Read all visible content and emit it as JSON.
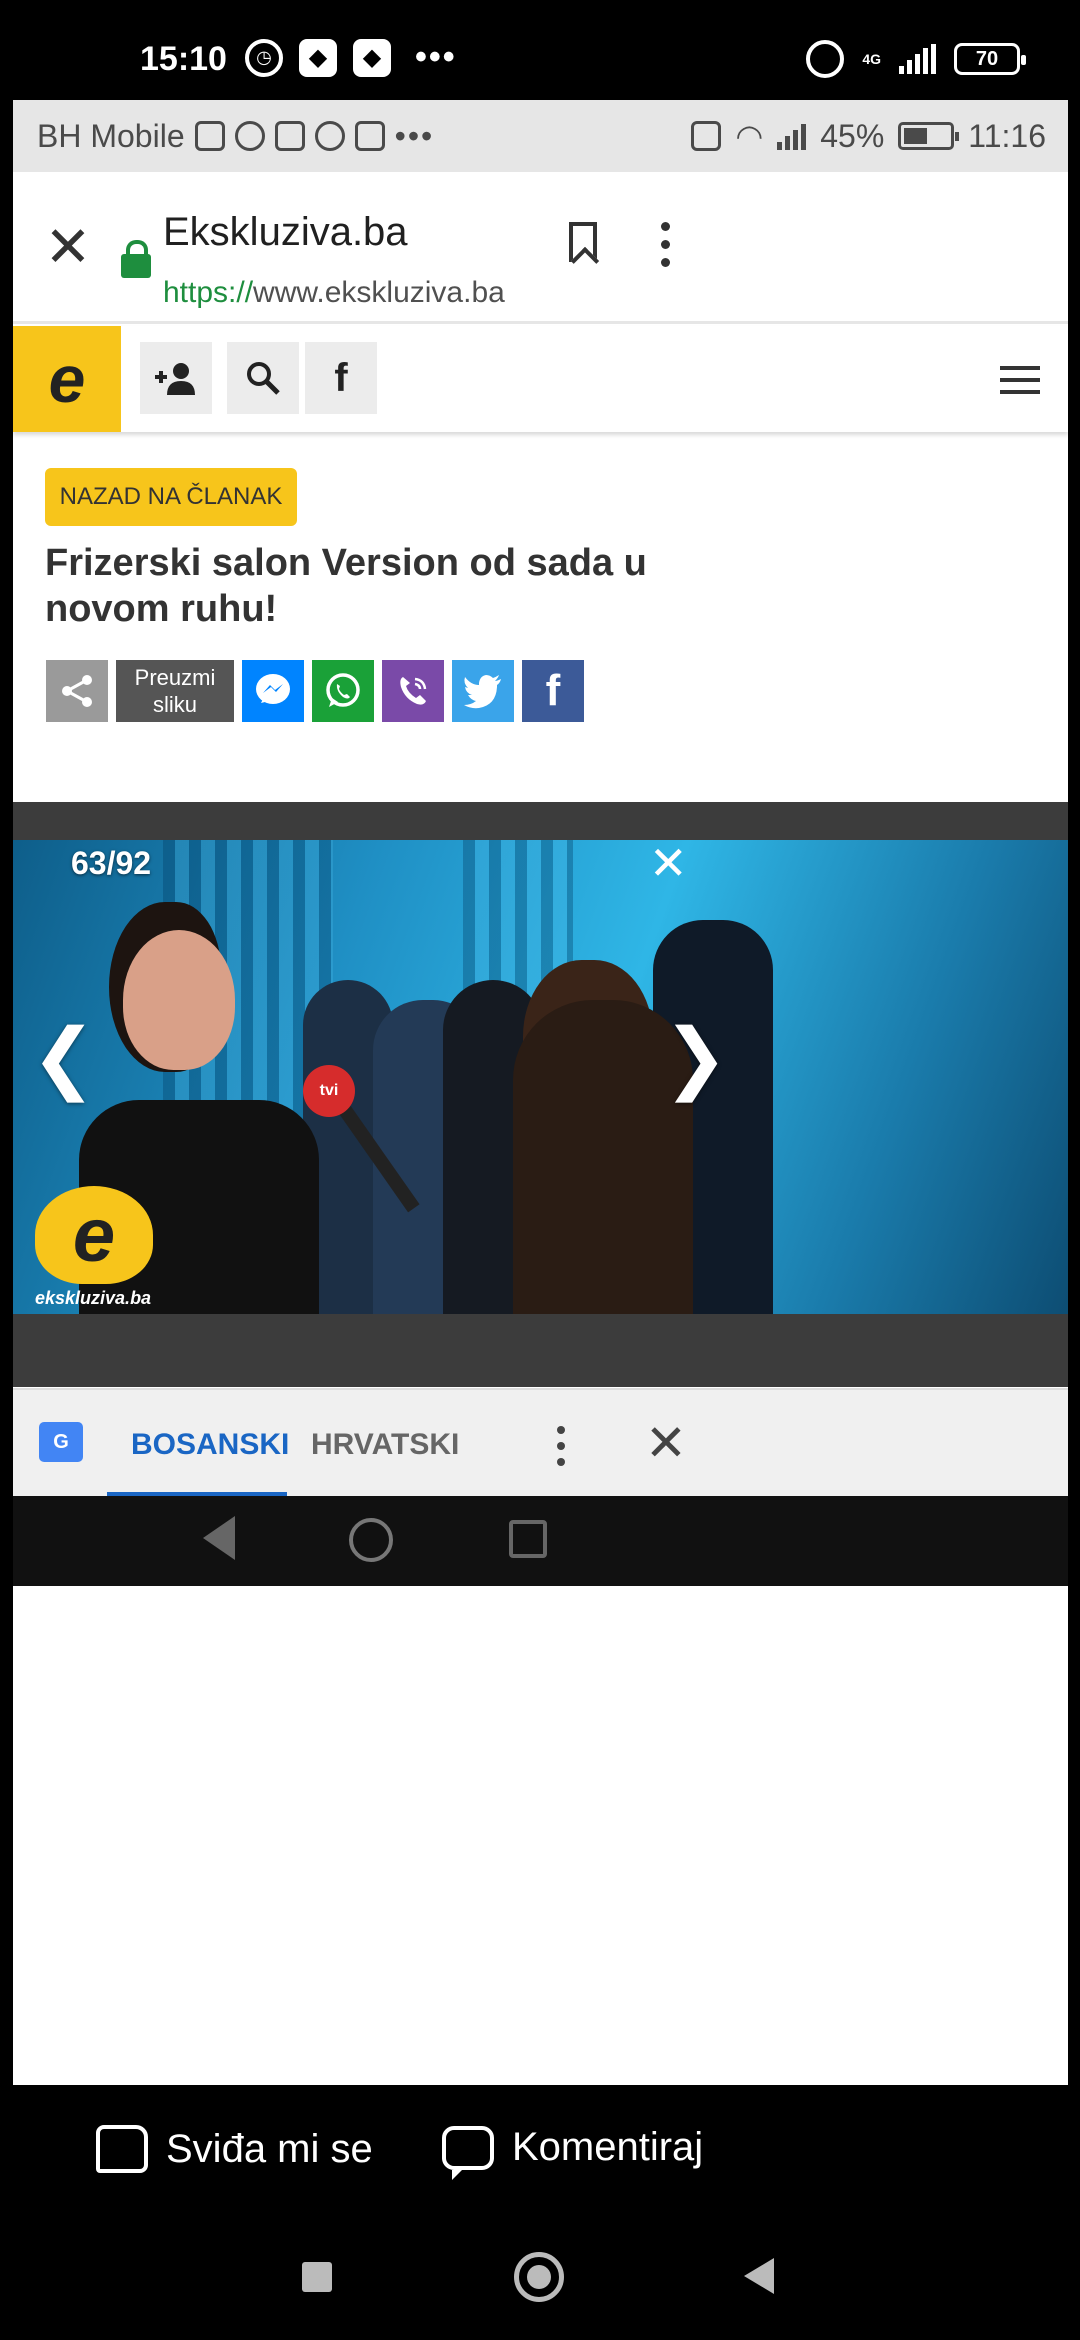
{
  "outer_status": {
    "time": "15:10",
    "network": "4G",
    "battery": "70"
  },
  "inner_status": {
    "carrier": "BH Mobile",
    "battery": "45%",
    "time": "11:16"
  },
  "browser": {
    "title": "Ekskluziva.ba",
    "url_scheme": "https://",
    "url_rest": "www.ekskluziva.ba"
  },
  "site": {
    "logo_letter": "e",
    "nav_icons": [
      "add-user-icon",
      "search-icon",
      "facebook-icon"
    ],
    "menu_icon": "hamburger-icon"
  },
  "article": {
    "back_label": "NAZAD NA ČLANAK",
    "headline": "Frizerski salon Version od sada u novom ruhu!",
    "download_label": "Preuzmi sliku",
    "share_buttons": [
      {
        "name": "share-icon",
        "color": "#9a9a9a"
      },
      {
        "name": "messenger-icon",
        "color": "#0084ff"
      },
      {
        "name": "whatsapp-icon",
        "color": "#1aa138"
      },
      {
        "name": "viber-icon",
        "color": "#7a4aa8"
      },
      {
        "name": "twitter-icon",
        "color": "#3aa4ea"
      },
      {
        "name": "facebook-icon",
        "color": "#3c5a98"
      }
    ]
  },
  "gallery": {
    "counter": "63/92",
    "watermark_text": "ekskluziva.ba",
    "mic_label": "tvi"
  },
  "translate": {
    "languages": [
      "BOSANSKI",
      "HRVATSKI"
    ],
    "active": "BOSANSKI"
  },
  "facebook_actions": {
    "like": "Sviđa mi se",
    "comment": "Komentiraj"
  },
  "colors": {
    "brand_yellow": "#f7c51b",
    "link_blue": "#1a66c4",
    "secure_green": "#1e8e3e"
  }
}
